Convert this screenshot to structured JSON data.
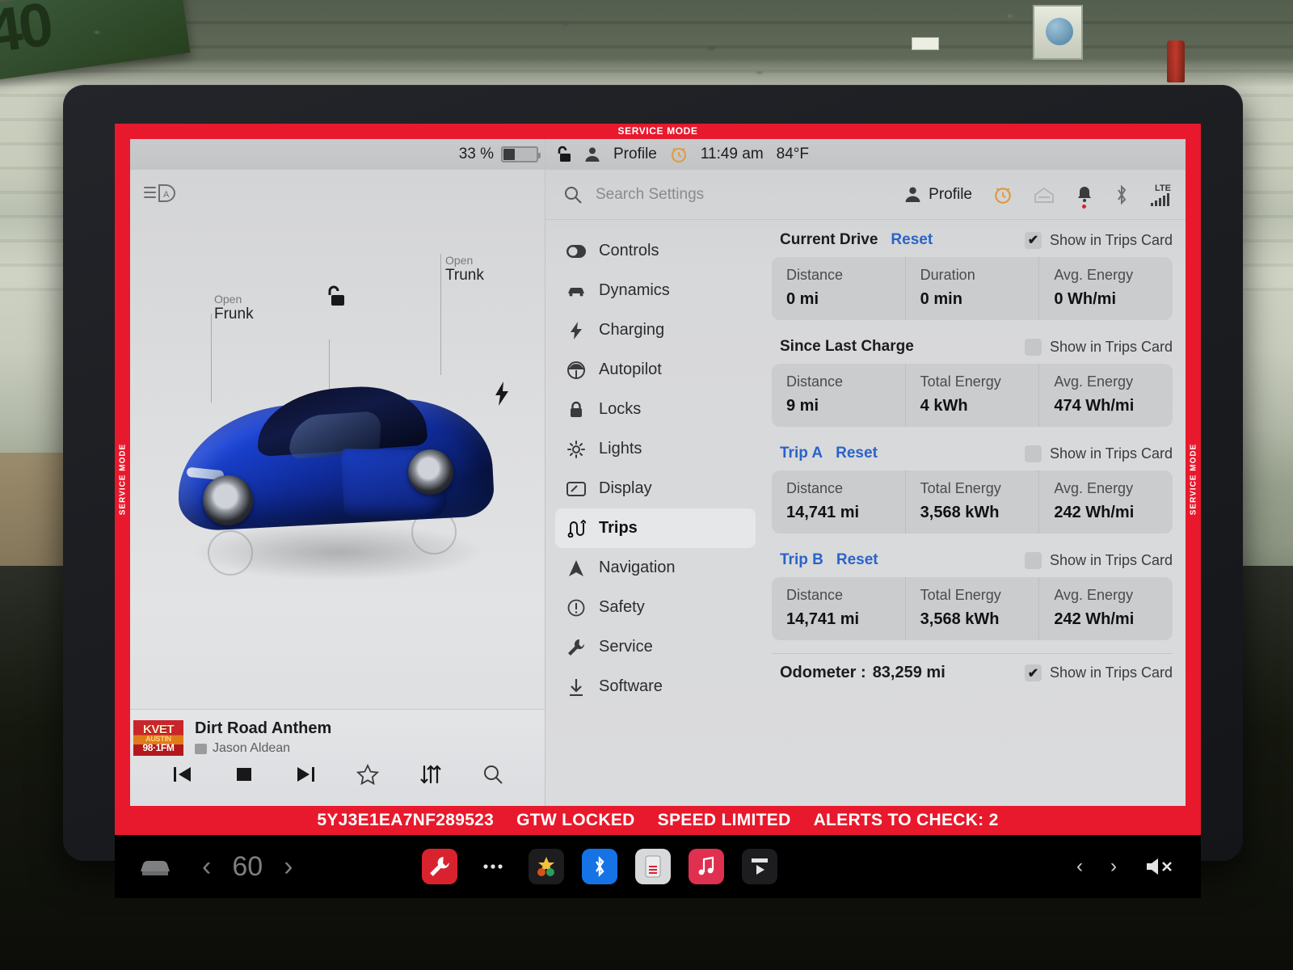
{
  "service_mode": {
    "top_banner": "SERVICE MODE",
    "rail_left": "SERVICE MODE",
    "rail_right": "SERVICE MODE",
    "accent_color": "#e8192c"
  },
  "bottom_status_bar": {
    "vin": "5YJ3E1EA7NF289523",
    "gateway": "GTW LOCKED",
    "speed": "SPEED LIMITED",
    "alerts": "ALERTS TO CHECK: 2"
  },
  "car_pane": {
    "battery_percent": "33 %",
    "battery_level": 33,
    "auto_headlight_icon": "auto-headlight-icon",
    "frunk": {
      "action": "Open",
      "name": "Frunk"
    },
    "trunk": {
      "action": "Open",
      "name": "Trunk"
    },
    "lock_icon": "unlocked-padlock-icon",
    "charge_port_icon": "charge-bolt-icon",
    "car_color": "#1a44d6"
  },
  "media": {
    "station_logo": {
      "line1": "KVET",
      "line2": "AUSTIN",
      "line3": "98·1FM"
    },
    "track_title": "Dirt Road Anthem",
    "artist": "Jason Aldean",
    "source_icon": "radio-icon",
    "controls": [
      {
        "name": "previous-track-button",
        "glyph": "prev"
      },
      {
        "name": "stop-button",
        "glyph": "stop"
      },
      {
        "name": "next-track-button",
        "glyph": "next"
      },
      {
        "name": "favorite-button",
        "glyph": "star"
      },
      {
        "name": "equalizer-button",
        "glyph": "sliders"
      },
      {
        "name": "search-media-button",
        "glyph": "search"
      }
    ]
  },
  "settings": {
    "status_bar": {
      "lock_icon": "unlocked-padlock-icon",
      "profile_icon": "person-icon",
      "profile_label": "Profile",
      "clock_icon": "alarm-clock-icon",
      "time": "11:49 am",
      "temperature": "84°F"
    },
    "search": {
      "placeholder": "Search Settings",
      "icon": "search-icon"
    },
    "header_icons": {
      "profile_label": "Profile",
      "profile_icon": "person-icon",
      "alarm_icon": "alarm-clock-icon",
      "garage_icon": "garage-door-icon",
      "bell_icon": "bell-icon",
      "bluetooth_icon": "bluetooth-icon",
      "network_label": "LTE",
      "signal_icon": "signal-bars-icon"
    },
    "menu": [
      {
        "label": "Controls",
        "icon": "toggle-icon",
        "active": false
      },
      {
        "label": "Dynamics",
        "icon": "car-icon",
        "active": false
      },
      {
        "label": "Charging",
        "icon": "bolt-icon",
        "active": false
      },
      {
        "label": "Autopilot",
        "icon": "steering-icon",
        "active": false
      },
      {
        "label": "Locks",
        "icon": "lock-icon",
        "active": false
      },
      {
        "label": "Lights",
        "icon": "sun-icon",
        "active": false
      },
      {
        "label": "Display",
        "icon": "display-icon",
        "active": false
      },
      {
        "label": "Trips",
        "icon": "trips-icon",
        "active": true
      },
      {
        "label": "Navigation",
        "icon": "navigation-icon",
        "active": false
      },
      {
        "label": "Safety",
        "icon": "warning-icon",
        "active": false
      },
      {
        "label": "Service",
        "icon": "wrench-icon",
        "active": false
      },
      {
        "label": "Software",
        "icon": "download-icon",
        "active": false
      }
    ]
  },
  "trips": {
    "checkbox_label": "Show in Trips Card",
    "reset_label": "Reset",
    "sections": [
      {
        "title": "Current Drive",
        "title_blue": false,
        "has_reset": true,
        "checked": true,
        "stats": [
          {
            "key": "Distance",
            "value": "0 mi"
          },
          {
            "key": "Duration",
            "value": "0 min"
          },
          {
            "key": "Avg. Energy",
            "value": "0 Wh/mi"
          }
        ]
      },
      {
        "title": "Since Last Charge",
        "title_blue": false,
        "has_reset": false,
        "checked": false,
        "stats": [
          {
            "key": "Distance",
            "value": "9 mi"
          },
          {
            "key": "Total Energy",
            "value": "4 kWh"
          },
          {
            "key": "Avg. Energy",
            "value": "474 Wh/mi"
          }
        ]
      },
      {
        "title": "Trip A",
        "title_blue": true,
        "has_reset": true,
        "checked": false,
        "stats": [
          {
            "key": "Distance",
            "value": "14,741 mi"
          },
          {
            "key": "Total Energy",
            "value": "3,568 kWh"
          },
          {
            "key": "Avg. Energy",
            "value": "242 Wh/mi"
          }
        ]
      },
      {
        "title": "Trip B",
        "title_blue": true,
        "has_reset": true,
        "checked": false,
        "stats": [
          {
            "key": "Distance",
            "value": "14,741 mi"
          },
          {
            "key": "Total Energy",
            "value": "3,568 kWh"
          },
          {
            "key": "Avg. Energy",
            "value": "242 Wh/mi"
          }
        ]
      }
    ],
    "odometer": {
      "label": "Odometer :",
      "value": "83,259 mi",
      "checked": true
    }
  },
  "taskbar": {
    "car_icon": "car-icon",
    "temp_down": "‹",
    "temperature": "60",
    "temp_up": "›",
    "apps": [
      {
        "name": "service-app-icon",
        "style": "red",
        "glyph": "wrench"
      },
      {
        "name": "more-apps-icon",
        "style": "transparent",
        "glyph": "dots"
      },
      {
        "name": "toybox-app-icon",
        "style": "dark",
        "glyph": "toybox"
      },
      {
        "name": "bluetooth-app-icon",
        "style": "blue",
        "glyph": "bluetooth"
      },
      {
        "name": "dashcam-app-icon",
        "style": "light",
        "glyph": "dashcam"
      },
      {
        "name": "music-app-icon",
        "style": "pink",
        "glyph": "music"
      },
      {
        "name": "theater-app-icon",
        "style": "dark",
        "glyph": "theater"
      }
    ],
    "nav_prev": "‹",
    "nav_next": "›",
    "mute_icon": "mute-speaker-icon"
  },
  "background": {
    "sign_text": "40",
    "wall_color": "#c5cab9"
  }
}
